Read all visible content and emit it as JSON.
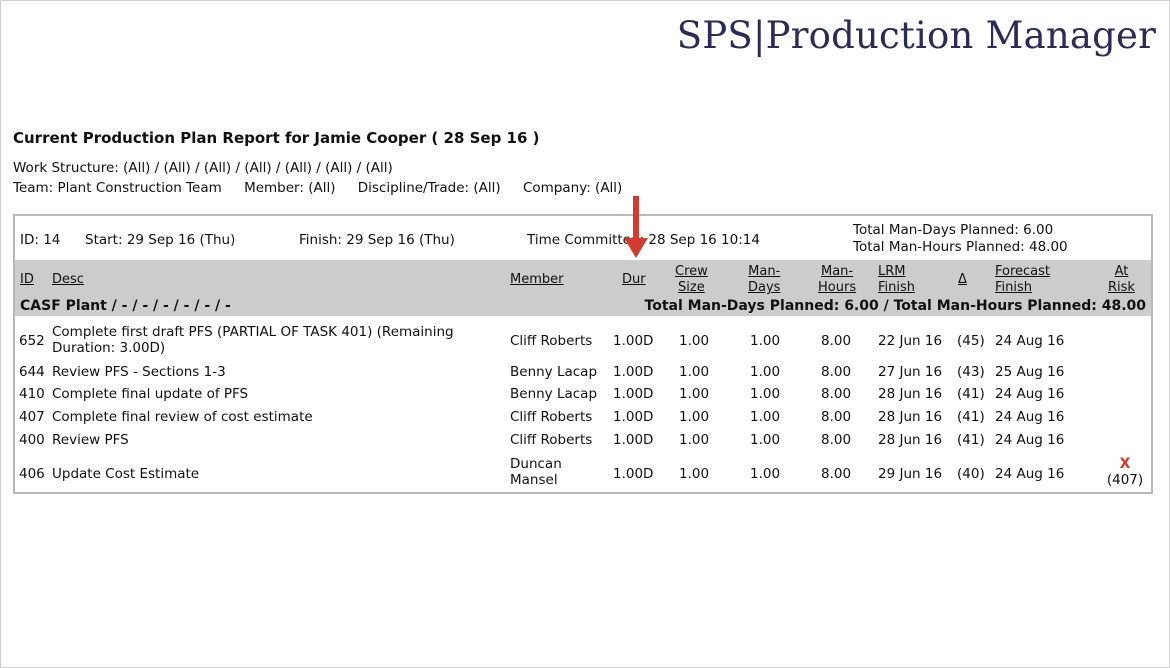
{
  "brand": {
    "text": "SPS|Production Manager"
  },
  "report": {
    "title": "Current Production Plan Report for Jamie Cooper ( 28 Sep 16 )",
    "work_structure": "Work Structure: (All) / (All) / (All) / (All) / (All) / (All) / (All)",
    "team": "Team: Plant Construction Team",
    "member": "Member: (All)",
    "discipline": "Discipline/Trade: (All)",
    "company": "Company: (All)"
  },
  "info": {
    "id": "ID: 14",
    "start": "Start: 29 Sep 16 (Thu)",
    "finish": "Finish: 29 Sep 16 (Thu)",
    "time_committed": "Time Committed: 28 Sep 16 10:14",
    "total_man_days": "Total Man-Days Planned: 6.00",
    "total_man_hours": "Total Man-Hours Planned: 48.00"
  },
  "columns": {
    "id": "ID",
    "desc": "Desc",
    "member": "Member",
    "dur": "Dur",
    "crew_size_1": "Crew",
    "crew_size_2": "Size",
    "man_days_1": "Man-",
    "man_days_2": "Days",
    "man_hours_1": "Man-",
    "man_hours_2": "Hours",
    "lrm_finish_1": "LRM",
    "lrm_finish_2": "Finish",
    "delta": "Δ",
    "forecast_finish_1": "Forecast",
    "forecast_finish_2": "Finish",
    "at_risk_1": "At",
    "at_risk_2": "Risk"
  },
  "group": {
    "label": "CASF Plant / - / - / - / - / - / -",
    "totals": "Total Man-Days Planned: 6.00 / Total Man-Hours Planned: 48.00"
  },
  "rows": [
    {
      "id": "652",
      "desc": "Complete first draft PFS (PARTIAL OF TASK 401) (Remaining Duration: 3.00D)",
      "member": "Cliff Roberts",
      "dur": "1.00D",
      "crew": "1.00",
      "days": "1.00",
      "hours": "8.00",
      "lrm": "22 Jun 16",
      "delta": "(45)",
      "forecast": "24 Aug 16",
      "risk": "",
      "risk_ref": ""
    },
    {
      "id": "644",
      "desc": "Review PFS - Sections 1-3",
      "member": "Benny Lacap",
      "dur": "1.00D",
      "crew": "1.00",
      "days": "1.00",
      "hours": "8.00",
      "lrm": "27 Jun 16",
      "delta": "(43)",
      "forecast": "25 Aug 16",
      "risk": "",
      "risk_ref": ""
    },
    {
      "id": "410",
      "desc": "Complete final update of PFS",
      "member": "Benny Lacap",
      "dur": "1.00D",
      "crew": "1.00",
      "days": "1.00",
      "hours": "8.00",
      "lrm": "28 Jun 16",
      "delta": "(41)",
      "forecast": "24 Aug 16",
      "risk": "",
      "risk_ref": ""
    },
    {
      "id": "407",
      "desc": "Complete final review of cost estimate",
      "member": "Cliff Roberts",
      "dur": "1.00D",
      "crew": "1.00",
      "days": "1.00",
      "hours": "8.00",
      "lrm": "28 Jun 16",
      "delta": "(41)",
      "forecast": "24 Aug 16",
      "risk": "",
      "risk_ref": ""
    },
    {
      "id": "400",
      "desc": "Review PFS",
      "member": "Cliff Roberts",
      "dur": "1.00D",
      "crew": "1.00",
      "days": "1.00",
      "hours": "8.00",
      "lrm": "28 Jun 16",
      "delta": "(41)",
      "forecast": "24 Aug 16",
      "risk": "",
      "risk_ref": ""
    },
    {
      "id": "406",
      "desc": "Update Cost Estimate",
      "member": "Duncan Mansel",
      "dur": "1.00D",
      "crew": "1.00",
      "days": "1.00",
      "hours": "8.00",
      "lrm": "29 Jun 16",
      "delta": "(40)",
      "forecast": "24 Aug 16",
      "risk": "X",
      "risk_ref": "(407)"
    }
  ],
  "colors": {
    "brand": "#2b2b5a",
    "header_bg": "#cccccc",
    "risk": "#d9342b",
    "arrow": "#d23c2e"
  }
}
